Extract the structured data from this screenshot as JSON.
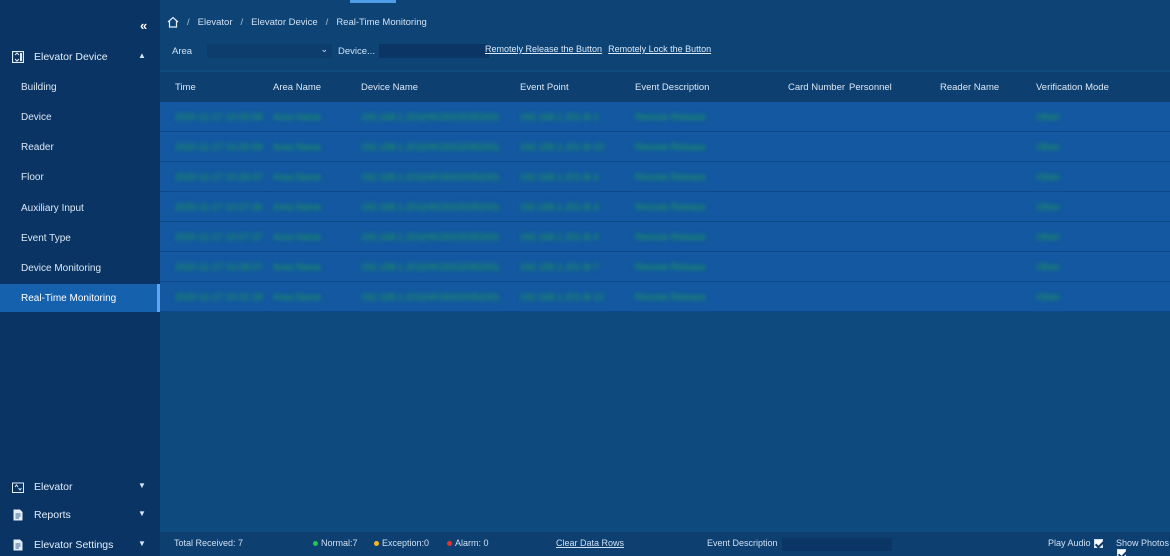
{
  "sidebar": {
    "collapse_glyph": "«",
    "groups": [
      {
        "label": "Elevator Device",
        "icon": "elevator-device-icon",
        "expanded": true
      },
      {
        "label": "Elevator",
        "icon": "elevator-icon",
        "expanded": false
      },
      {
        "label": "Reports",
        "icon": "reports-icon",
        "expanded": false
      },
      {
        "label": "Elevator Settings",
        "icon": "settings-doc-icon",
        "expanded": false
      }
    ],
    "items": [
      {
        "label": "Building"
      },
      {
        "label": "Device"
      },
      {
        "label": "Reader"
      },
      {
        "label": "Floor"
      },
      {
        "label": "Auxiliary Input"
      },
      {
        "label": "Event Type"
      },
      {
        "label": "Device Monitoring"
      },
      {
        "label": "Real-Time Monitoring",
        "active": true
      }
    ]
  },
  "breadcrumb": [
    "Elevator",
    "Elevator Device",
    "Real-Time Monitoring"
  ],
  "filters": {
    "area_label": "Area",
    "device_label": "Device..."
  },
  "actions": {
    "release": "Remotely Release the Button",
    "lock": "Remotely Lock the Button"
  },
  "table": {
    "columns": [
      "Time",
      "Area Name",
      "Device Name",
      "Event Point",
      "Event Description",
      "Card Number",
      "Personnel",
      "Reader Name",
      "Verification Mode"
    ],
    "rows": [
      {
        "time": "2020-11-17 10:25:58",
        "area": "Area Name",
        "device": "192.168.1.201(HKGKD2035200)",
        "point": "192.168.1.201-B-1",
        "desc": "Remote Release",
        "verify": "Other"
      },
      {
        "time": "2020-11-17 10:25:59",
        "area": "Area Name",
        "device": "192.168.1.201(HKGKD2035200)",
        "point": "192.168.1.201-B-10",
        "desc": "Remote Release",
        "verify": "Other"
      },
      {
        "time": "2020-11-17 10:26:07",
        "area": "Area Name",
        "device": "192.168.1.201(HKGKD2035200)",
        "point": "192.168.1.201-B-2",
        "desc": "Remote Release",
        "verify": "Other"
      },
      {
        "time": "2020-11-17 10:27:36",
        "area": "Area Name",
        "device": "192.168.1.201(HKGKD2035200)",
        "point": "192.168.1.201-B-3",
        "desc": "Remote Release",
        "verify": "Other"
      },
      {
        "time": "2020-11-17 10:27:37",
        "area": "Area Name",
        "device": "192.168.1.201(HKGKD2035200)",
        "point": "192.168.1.201-B-4",
        "desc": "Remote Release",
        "verify": "Other"
      },
      {
        "time": "2020-11-17 10:28:07",
        "area": "Area Name",
        "device": "192.168.1.201(HKGKD2035200)",
        "point": "192.168.1.201-B-7",
        "desc": "Remote Release",
        "verify": "Other"
      },
      {
        "time": "2020-11-17 10:31:18",
        "area": "Area Name",
        "device": "192.168.1.201(HKGKD2035200)",
        "point": "192.168.1.201-B-12",
        "desc": "Remote Release",
        "verify": "Other"
      }
    ]
  },
  "status": {
    "total_received": "Total Received: 7",
    "normal": "Normal:7",
    "exception": "Exception:0",
    "alarm": "Alarm: 0",
    "clear": "Clear Data Rows",
    "event_desc_label": "Event Description",
    "play_audio": "Play Audio",
    "show_photos": "Show Photos",
    "colors": {
      "normal": "#27c44e",
      "exception": "#f2b824",
      "alarm": "#e8322b"
    }
  }
}
